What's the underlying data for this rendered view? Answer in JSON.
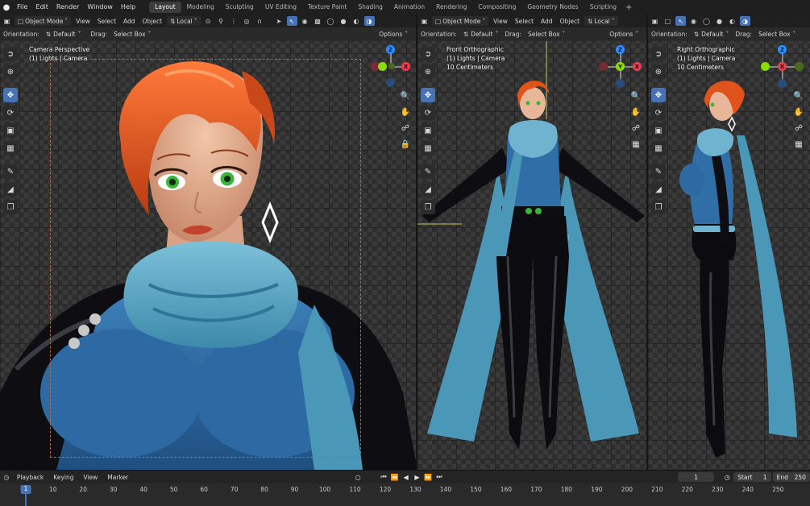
{
  "menubar": {
    "logo": "blender-logo",
    "items": [
      "File",
      "Edit",
      "Render",
      "Window",
      "Help"
    ],
    "workspaces": [
      "Layout",
      "Modeling",
      "Sculpting",
      "UV Editing",
      "Texture Paint",
      "Shading",
      "Animation",
      "Rendering",
      "Compositing",
      "Geometry Nodes",
      "Scripting"
    ],
    "active_workspace": "Layout",
    "add_tab": "+"
  },
  "viewport_header": {
    "mode": "Object Mode",
    "menus": [
      "View",
      "Select",
      "Add",
      "Object"
    ],
    "transform_orientation": "Local"
  },
  "tool_settings": {
    "orientation_label": "Orientation:",
    "orientation_value": "Default",
    "drag_label": "Drag:",
    "drag_value": "Select Box",
    "options": "Options"
  },
  "viewports": [
    {
      "title": "Camera Perspective",
      "collection": "(1) Lights | Camera",
      "scale": ""
    },
    {
      "title": "Front Orthographic",
      "collection": "(1) Lights | Camera",
      "scale": "10 Centimeters"
    },
    {
      "title": "Right Orthographic",
      "collection": "(1) Lights | Camera",
      "scale": "10 Centimeters"
    }
  ],
  "gizmo_labels": {
    "x": "X",
    "y": "Y",
    "z": "Z"
  },
  "timeline": {
    "menus": [
      "Playback",
      "Keying",
      "View",
      "Marker"
    ],
    "current_frame": "1",
    "start_label": "Start",
    "start": "1",
    "end_label": "End",
    "end": "250",
    "ruler_ticks": [
      "10",
      "20",
      "30",
      "40",
      "50",
      "60",
      "70",
      "80",
      "90",
      "100",
      "110",
      "120",
      "130",
      "140",
      "150",
      "160",
      "170",
      "180",
      "190",
      "200",
      "210",
      "220",
      "230",
      "240",
      "250"
    ],
    "cursor_frame": "1"
  },
  "colors": {
    "accent": "#4772b3",
    "hair": "#e0541c",
    "sweater": "#2f6ea6",
    "scarf": "#4f9ec0",
    "latex": "#0c0c10",
    "skin": "#e8b79a",
    "eyes": "#3ab53a"
  }
}
